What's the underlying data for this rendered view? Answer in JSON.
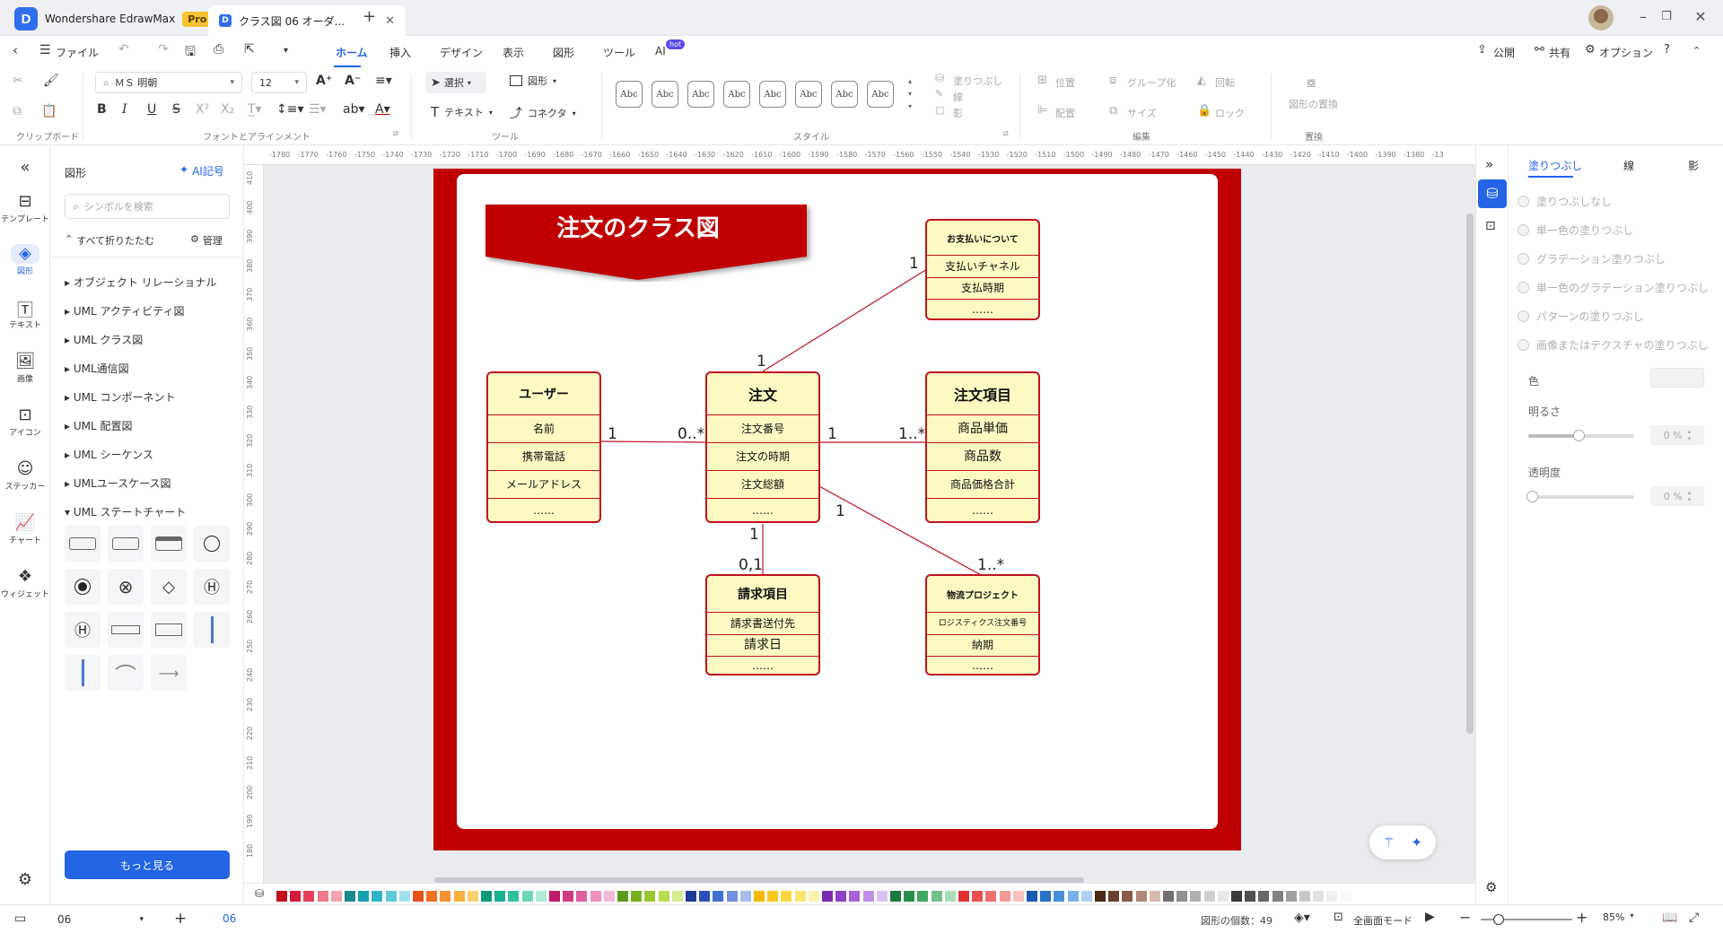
{
  "titlebar": {
    "app_name": "Wondershare EdrawMax",
    "pro_badge": "Pro",
    "tab_title": "クラス図 06 オーダ...",
    "new_tab": "+"
  },
  "menubar": {
    "file": "ファイル",
    "tabs": [
      "ホーム",
      "挿入",
      "デザイン",
      "表示",
      "図形",
      "ツール",
      "AI"
    ],
    "ai_badge": "hot",
    "active_tab": "ホーム",
    "publish": "公開",
    "share": "共有",
    "options": "オプション"
  },
  "ribbon": {
    "font_name": "ＭＳ 明朝",
    "font_size": "12",
    "select": "選択",
    "shape": "図形",
    "text": "テキスト",
    "connector": "コネクタ",
    "style_sample": "Abc",
    "fill": "塗りつぶし",
    "line": "線",
    "shadow": "影",
    "position": "位置",
    "align": "配置",
    "group": "グループ化",
    "size": "サイズ",
    "rotate": "回転",
    "lock": "ロック",
    "replace_shape": "図形の置換",
    "groups": {
      "clipboard": "クリップボード",
      "font": "フォントとアラインメント",
      "tools": "ツール",
      "style": "スタイル",
      "edit": "編集",
      "replace": "置換"
    }
  },
  "leftnav": {
    "items": [
      "テンプレート",
      "図形",
      "テキスト",
      "画像",
      "アイコン",
      "ステッカー",
      "チャート",
      "ウィジェット"
    ],
    "active": "図形"
  },
  "library": {
    "title": "図形",
    "ai_btn": "AI記号",
    "search_placeholder": "シンボルを検索",
    "collapse_all": "すべて折りたたむ",
    "manage": "管理",
    "categories": [
      "オブジェクト リレーショナル",
      "UML アクティビティ図",
      "UML クラス図",
      "UML通信図",
      "UML コンポーネント",
      "UML 配置図",
      "UML シーケンス",
      "UMLユースケース図",
      "UML ステートチャート"
    ],
    "more_btn": "もっと見る"
  },
  "ruler": {
    "h_ticks": [
      "-1780",
      "-1770",
      "-1760",
      "-1750",
      "-1740",
      "-1730",
      "-1720",
      "-1710",
      "-1700",
      "-1690",
      "-1680",
      "-1670",
      "-1660",
      "-1650",
      "-1640",
      "-1630",
      "-1620",
      "-1610",
      "-1600",
      "-1590",
      "-1580",
      "-1570",
      "-1560",
      "-1550",
      "-1540",
      "-1530",
      "-1520",
      "-1510",
      "-1500",
      "-1490",
      "-1480",
      "-1470",
      "-1460",
      "-1450",
      "-1440",
      "-1430",
      "-1420",
      "-1410",
      "-1400",
      "-1390",
      "-1380",
      "-13"
    ],
    "v_ticks": [
      "410",
      "400",
      "390",
      "380",
      "370",
      "360",
      "350",
      "340",
      "330",
      "320",
      "310",
      "300",
      "290",
      "280",
      "270",
      "260",
      "250",
      "240",
      "230",
      "220",
      "210",
      "200",
      "190",
      "180"
    ]
  },
  "diagram": {
    "title": "注文のクラス図",
    "classes": {
      "payment": {
        "name": "お支払いについて",
        "rows": [
          "支払いチャネル",
          "支払時期",
          "……"
        ]
      },
      "user": {
        "name": "ユーザー",
        "rows": [
          "名前",
          "携帯電話",
          "メールアドレス",
          "……"
        ]
      },
      "order": {
        "name": "注文",
        "rows": [
          "注文番号",
          "注文の時期",
          "注文総額",
          "……"
        ]
      },
      "order_item": {
        "name": "注文項目",
        "rows": [
          "商品単価",
          "商品数",
          "商品価格合計",
          "……"
        ]
      },
      "billing": {
        "name": "請求項目",
        "rows": [
          "請求書送付先",
          "請求日",
          "……"
        ]
      },
      "logistics": {
        "name": "物流プロジェクト",
        "rows": [
          "ロジスティクス注文番号",
          "納期",
          "……"
        ]
      }
    },
    "multiplicities": {
      "order_payment_top": "1",
      "order_payment_bottom": "1",
      "user_order_left": "1",
      "user_order_right": "0..*",
      "order_item_left": "1",
      "order_item_right": "1..*",
      "order_billing_top": "1",
      "order_billing_bottom": "0,1",
      "order_logistics_left": "1",
      "order_logistics_right": "1..*"
    }
  },
  "rightpanel": {
    "tabs": [
      "塗りつぶし",
      "線",
      "影"
    ],
    "fill_options": [
      "塗りつぶしなし",
      "単一色の塗りつぶし",
      "グラデーション塗りつぶし",
      "単一色のグラデーション塗りつぶし",
      "パターンの塗りつぶし",
      "画像またはテクスチャの塗りつぶし"
    ],
    "color_label": "色",
    "brightness_label": "明るさ",
    "brightness_value": "0 %",
    "transparency_label": "透明度",
    "transparency_value": "0 %"
  },
  "statusbar": {
    "page_select": "06",
    "add_page": "+",
    "page_tab": "06",
    "shape_count": "図形の個数：49",
    "fullscreen": "全画面モード",
    "zoom": "85%"
  },
  "colors": {
    "accent": "#2465e6",
    "page_red": "#c00000",
    "class_fill": "#fdf9c2",
    "class_border": "#c01020",
    "palette": [
      "#c0101f",
      "#d21a3a",
      "#e63e5a",
      "#f07a8a",
      "#f5a3b0",
      "#1a8a8a",
      "#19a0b0",
      "#2fb5c8",
      "#5fc9d8",
      "#a0e0e8",
      "#e8501a",
      "#f07020",
      "#f59030",
      "#f8b040",
      "#fad070",
      "#0e9a7a",
      "#18b090",
      "#30c0a0",
      "#70d5b8",
      "#b0e8d5",
      "#c01a6a",
      "#d03a80",
      "#e060a0",
      "#f090c0",
      "#f5b8d8",
      "#5a9a1a",
      "#78b020",
      "#98c830",
      "#b8dc50",
      "#d5ec90",
      "#1a3a9a",
      "#2a50b8",
      "#4070d0",
      "#7090e0",
      "#a8bcef",
      "#f5b800",
      "#f8c820",
      "#fad840",
      "#fbe470",
      "#fdf0b0",
      "#7a2ab0",
      "#9040c8",
      "#a860d8",
      "#c090e8",
      "#dcc0f2",
      "#1a7a3a",
      "#28904a",
      "#40a860",
      "#70c088",
      "#a8dcb8",
      "#e03030",
      "#e85050",
      "#f07070",
      "#f59898",
      "#fac0c0",
      "#1a5ab0",
      "#2870c8",
      "#4890dc",
      "#78b0e8",
      "#b0d0f2",
      "#4a2a1a",
      "#6a4030",
      "#8a5a48",
      "#b08878",
      "#d8b8a8",
      "#707070",
      "#909090",
      "#b0b0b0",
      "#d0d0d0",
      "#e8e8e8",
      "#3a3a3a",
      "#505050",
      "#686868",
      "#808080",
      "#a0a0a0",
      "#c8c8c8",
      "#e0e0e0",
      "#f0f0f0",
      "#fafafa",
      "#ffffff"
    ]
  }
}
